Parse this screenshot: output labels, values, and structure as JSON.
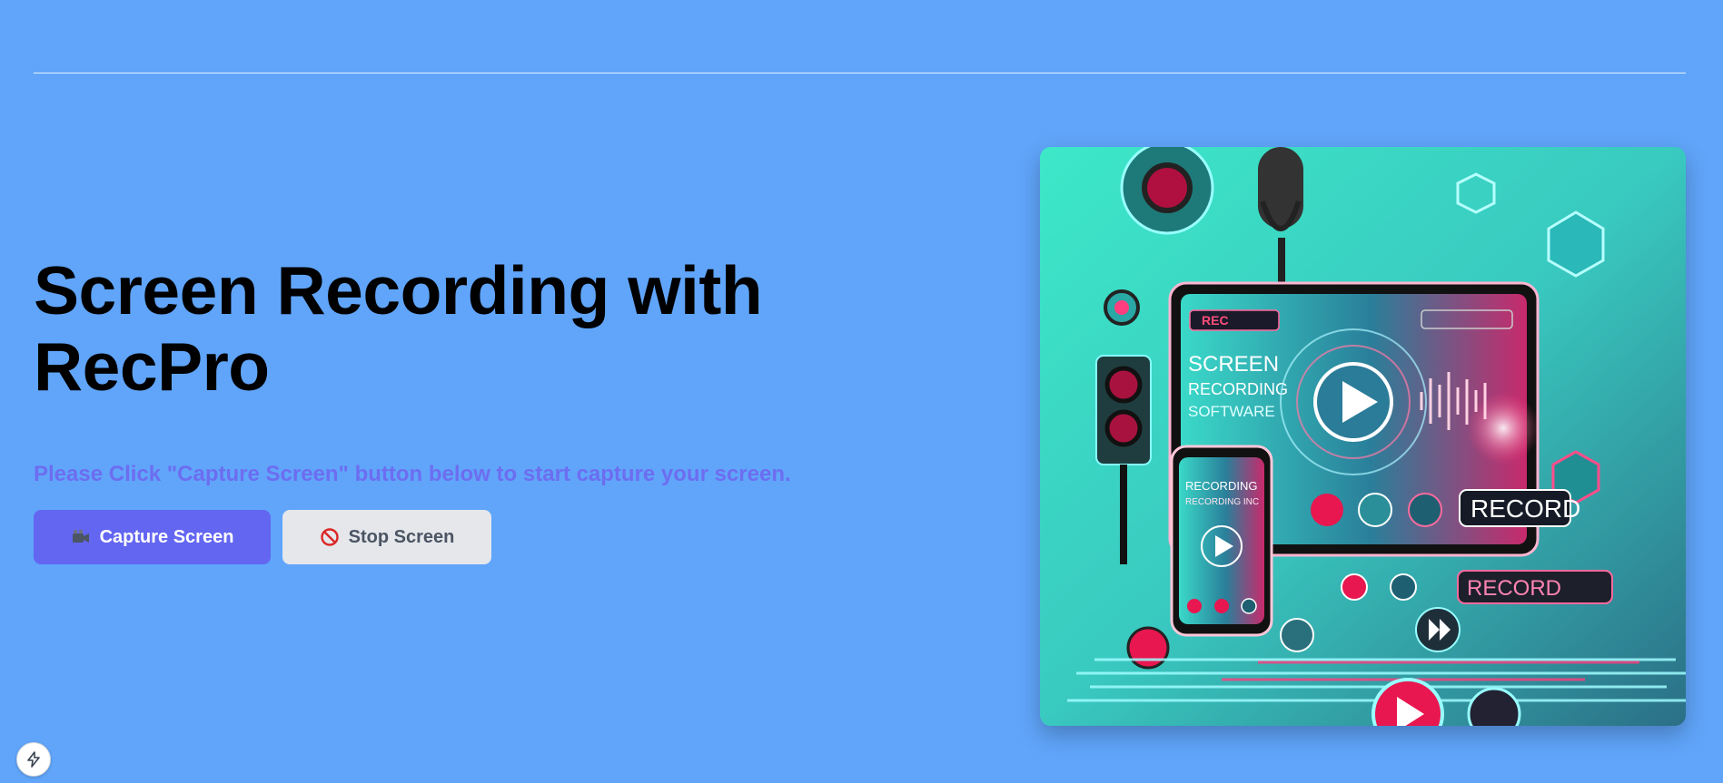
{
  "hero": {
    "title": "Screen Recording with RecPro",
    "subtitle": "Please Click \"Capture Screen\" button below to start capture your screen."
  },
  "buttons": {
    "capture_label": "Capture Screen",
    "capture_icon": "video-camera-icon",
    "stop_label": "Stop Screen",
    "stop_icon": "prohibited-icon"
  },
  "image": {
    "alt": "Screen recording software illustration",
    "texts": {
      "tablet_headline_1": "SCREEN",
      "tablet_headline_2": "RECORDING",
      "tablet_headline_3": "SOFTWARE",
      "tablet_status": "REC",
      "phone_caption_1": "RECORDING",
      "phone_caption_2": "RECORDING INC",
      "record_badge": "RECORD",
      "record_badge_2": "RECORD"
    }
  },
  "colors": {
    "background": "#60a5fa",
    "primary": "#6366f1",
    "subtitle": "#6d6df0",
    "secondary_button": "#e5e7eb",
    "accent_pink": "#ff2d6b",
    "accent_teal": "#2ee6d6"
  },
  "dev_badge": {
    "icon": "lightning-bolt-icon"
  }
}
